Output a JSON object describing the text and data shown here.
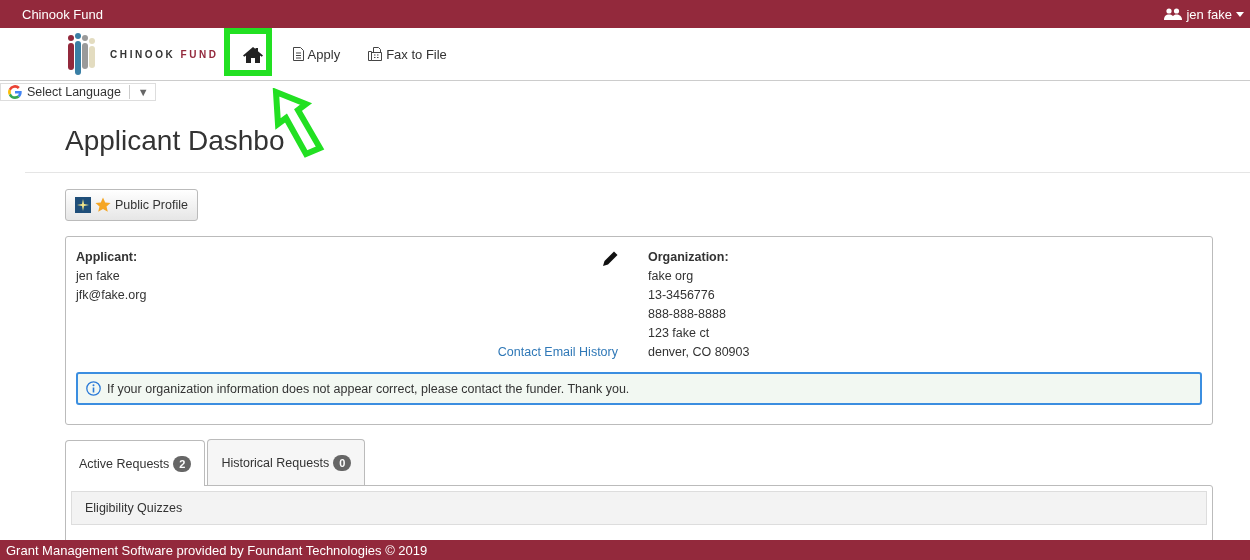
{
  "top_bar": {
    "title": "Chinook Fund",
    "user": "jen fake"
  },
  "nav": {
    "logo_words": [
      "CHINOOK",
      "FUND"
    ],
    "items": [
      {
        "kind": "home"
      },
      {
        "kind": "apply",
        "label": "Apply"
      },
      {
        "kind": "fax",
        "label": "Fax to File"
      }
    ]
  },
  "language": {
    "label": "Select Language",
    "caret": "▼"
  },
  "page_title": "Applicant Dashbo",
  "public_profile": "Public Profile",
  "applicant": {
    "heading": "Applicant:",
    "lines": [
      "jen fake",
      "jfk@fake.org"
    ],
    "link": "Contact Email History"
  },
  "organization": {
    "heading": "Organization:",
    "lines": [
      "fake org",
      "13-3456776",
      "888-888-8888",
      "123 fake ct",
      "denver, CO 80903"
    ]
  },
  "notice": "If your organization information does not appear correct, please contact the funder. Thank you.",
  "tabs": [
    {
      "label": "Active Requests",
      "count": "2",
      "selected": true
    },
    {
      "label": "Historical Requests",
      "count": "0",
      "selected": false
    }
  ],
  "panel": {
    "heading": "Eligibility Quizzes"
  },
  "footer": "Grant Management Software provided by Foundant Technologies © 2019"
}
